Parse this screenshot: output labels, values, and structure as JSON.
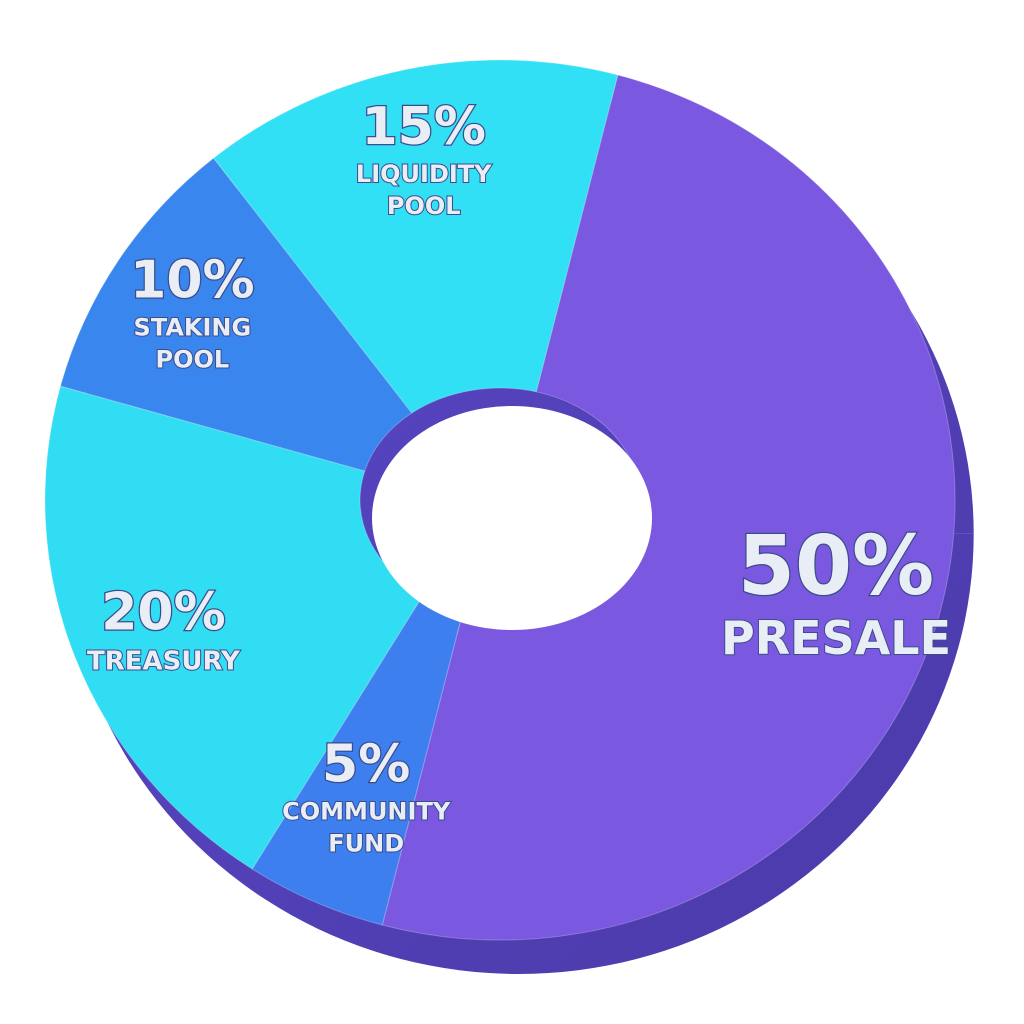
{
  "chart_data": {
    "type": "pie",
    "title": "",
    "slices": [
      {
        "percent_label": "50%",
        "name_lines": [
          "PRESALE"
        ],
        "value": 50,
        "color": "#7a58e0"
      },
      {
        "percent_label": "5%",
        "name_lines": [
          "COMMUNITY",
          "FUND"
        ],
        "value": 5,
        "color": "#3e7fef"
      },
      {
        "percent_label": "20%",
        "name_lines": [
          "TREASURY"
        ],
        "value": 20,
        "color": "#31ddf2"
      },
      {
        "percent_label": "10%",
        "name_lines": [
          "STAKING",
          "POOL"
        ],
        "value": 10,
        "color": "#3a86ef"
      },
      {
        "percent_label": "15%",
        "name_lines": [
          "LIQUIDITY",
          "POOL"
        ],
        "value": 15,
        "color": "#31e0f4"
      }
    ],
    "legend": "none",
    "style": "3d-donut"
  }
}
